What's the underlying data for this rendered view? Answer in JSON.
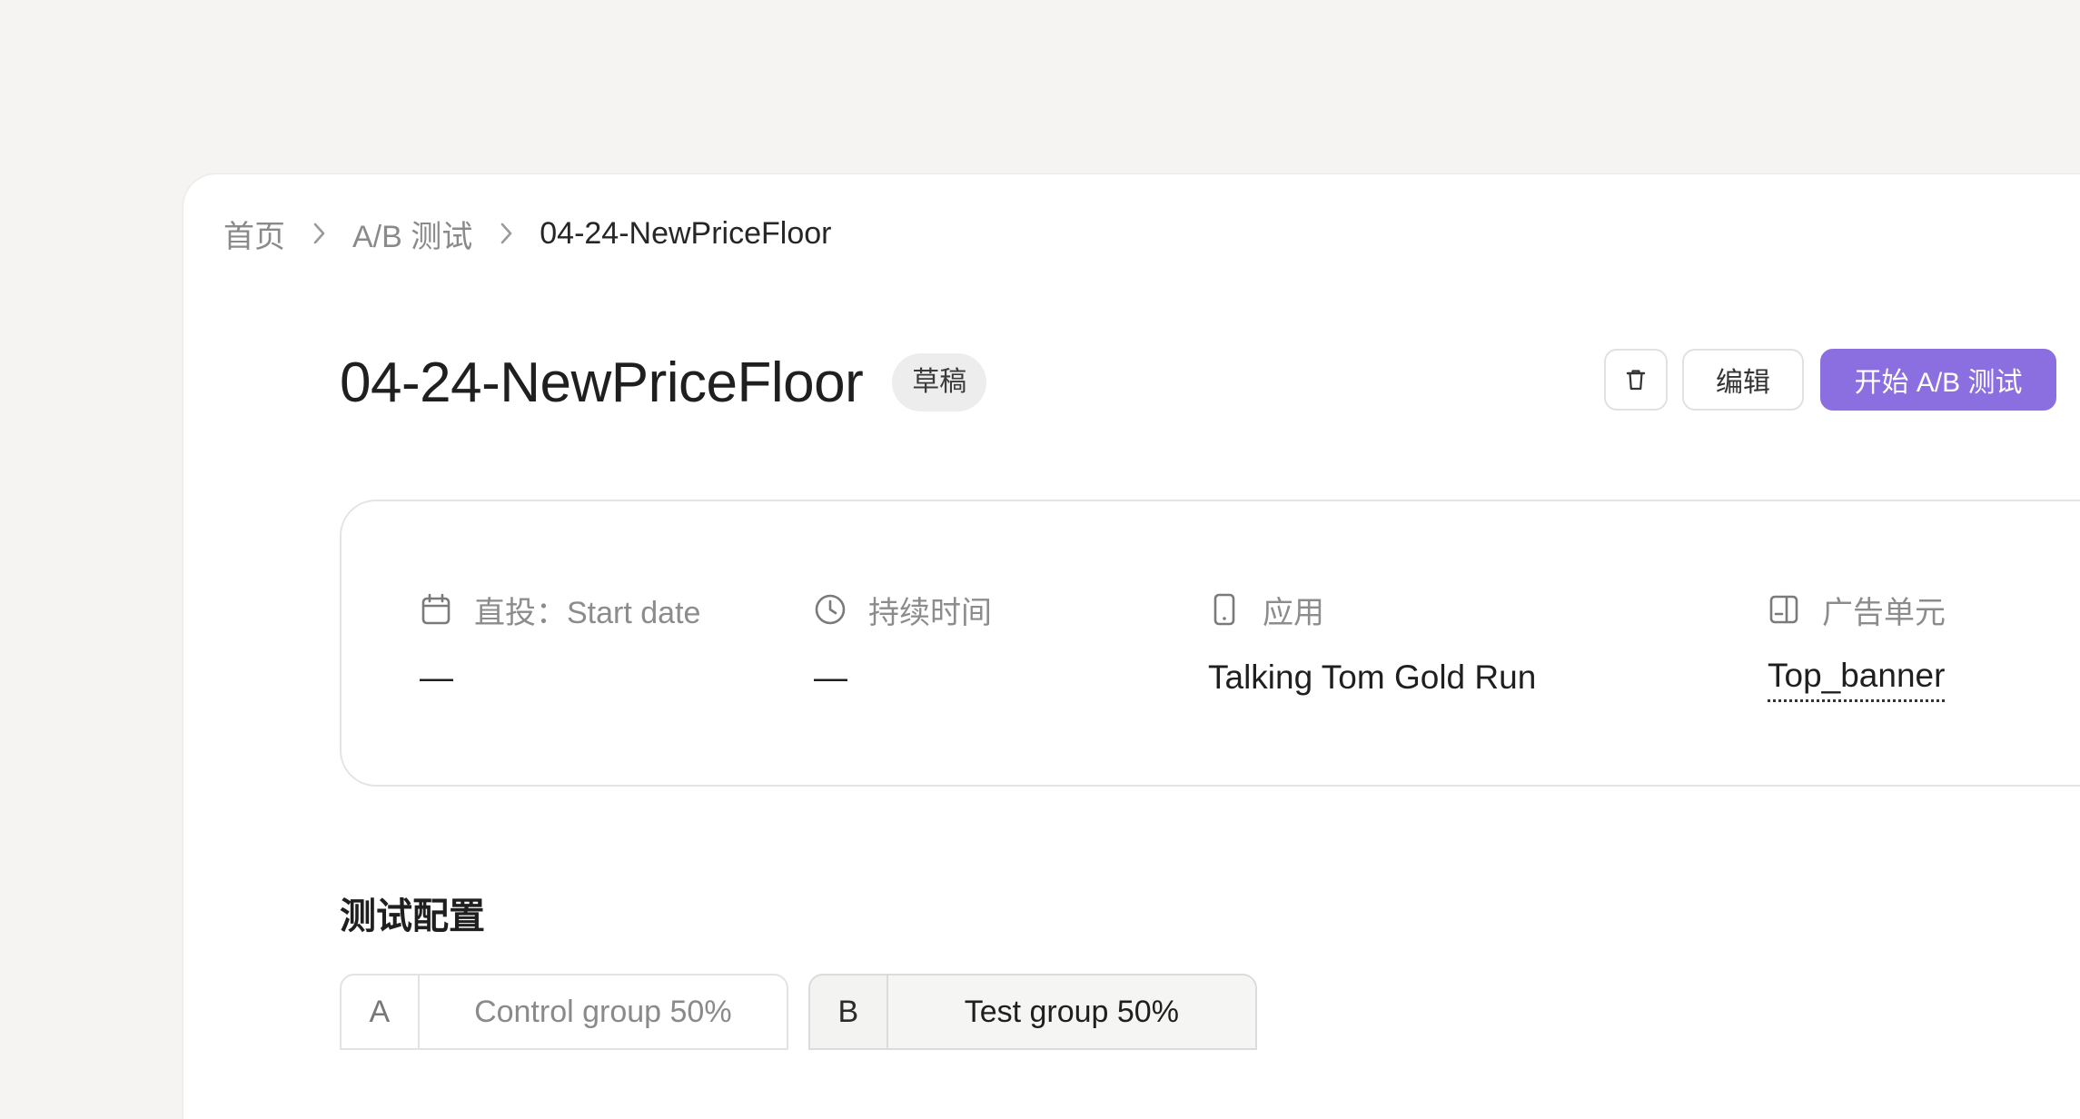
{
  "breadcrumb": {
    "home": "首页",
    "section": "A/B 测试",
    "current": "04-24-NewPriceFloor"
  },
  "header": {
    "title": "04-24-NewPriceFloor",
    "status": "草稿",
    "edit_label": "编辑",
    "start_label": "开始 A/B 测试",
    "delete_icon": "trash-icon"
  },
  "info": {
    "start_date": {
      "icon": "calendar-icon",
      "label": "直投：Start date",
      "value": "—"
    },
    "duration": {
      "icon": "clock-icon",
      "label": "持续时间",
      "value": "—"
    },
    "app": {
      "icon": "phone-icon",
      "label": "应用",
      "value": "Talking Tom Gold Run"
    },
    "ad_unit": {
      "icon": "ad-unit-icon",
      "label": "广告单元",
      "value": "Top_banner"
    }
  },
  "config": {
    "title": "测试配置",
    "groups": [
      {
        "letter": "A",
        "label": "Control group 50%"
      },
      {
        "letter": "B",
        "label": "Test group 50%"
      }
    ]
  },
  "colors": {
    "primary": "#8b6fe0",
    "background": "#f5f4f2",
    "badge": "#ededed"
  }
}
